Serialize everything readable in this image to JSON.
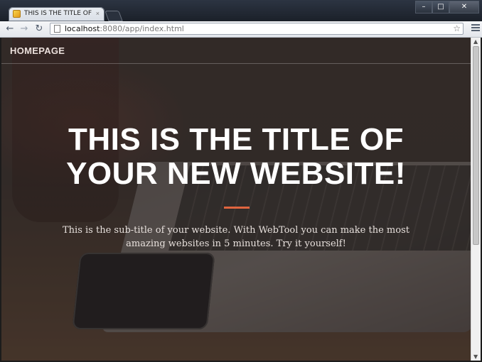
{
  "browser": {
    "tab_title": "THIS IS THE TITLE OF YOU",
    "tab_close": "×",
    "address": {
      "host": "localhost",
      "rest": ":8080/app/index.html"
    },
    "window_buttons": {
      "minimize": "–",
      "maximize": "□",
      "close": "✕"
    },
    "nav": {
      "back": "←",
      "forward": "→",
      "reload": "↻",
      "star": "☆"
    }
  },
  "page": {
    "brand": "HOMEPAGE",
    "title_line1": "THIS IS THE TITLE OF",
    "title_line2": "YOUR NEW WEBSITE!",
    "subtitle_line1": "This is the sub-title of your website. With WebTool you can make the most",
    "subtitle_line2": "amazing websites in 5 minutes. Try it yourself!",
    "accent_color": "#e0653f"
  },
  "scrollbar": {
    "up": "▲",
    "down": "▼"
  }
}
